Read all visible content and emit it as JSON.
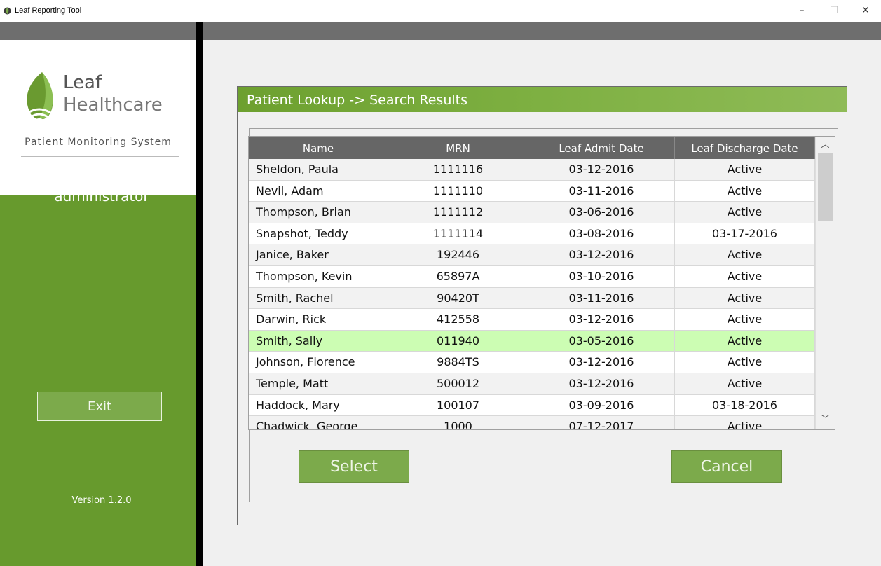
{
  "window": {
    "title": "Leaf Reporting Tool",
    "minimize": "–",
    "maximize": "☐",
    "close": "✕"
  },
  "sidebar": {
    "brand_line1": "Leaf",
    "brand_line2": "Healthcare",
    "tagline": "Patient Monitoring System",
    "username": "administrator",
    "exit_label": "Exit",
    "version": "Version 1.2.0"
  },
  "panel": {
    "title": "Patient Lookup -> Search Results",
    "select_label": "Select",
    "cancel_label": "Cancel"
  },
  "table": {
    "columns": [
      "Name",
      "MRN",
      "Leaf Admit Date",
      "Leaf Discharge Date"
    ],
    "rows": [
      {
        "name": "Sheldon, Paula",
        "mrn": "1111116",
        "admit": "03-12-2016",
        "discharge": "Active"
      },
      {
        "name": "Nevil, Adam",
        "mrn": "1111110",
        "admit": "03-11-2016",
        "discharge": "Active"
      },
      {
        "name": "Thompson, Brian",
        "mrn": "1111112",
        "admit": "03-06-2016",
        "discharge": "Active"
      },
      {
        "name": "Snapshot, Teddy",
        "mrn": "1111114",
        "admit": "03-08-2016",
        "discharge": "03-17-2016"
      },
      {
        "name": "Janice, Baker",
        "mrn": "192446",
        "admit": "03-12-2016",
        "discharge": "Active"
      },
      {
        "name": "Thompson, Kevin",
        "mrn": "65897A",
        "admit": "03-10-2016",
        "discharge": "Active"
      },
      {
        "name": "Smith, Rachel",
        "mrn": "90420T",
        "admit": "03-11-2016",
        "discharge": "Active"
      },
      {
        "name": "Darwin, Rick",
        "mrn": "412558",
        "admit": "03-12-2016",
        "discharge": "Active"
      },
      {
        "name": "Smith, Sally",
        "mrn": "011940",
        "admit": "03-05-2016",
        "discharge": "Active",
        "selected": true
      },
      {
        "name": "Johnson, Florence",
        "mrn": "9884TS",
        "admit": "03-12-2016",
        "discharge": "Active"
      },
      {
        "name": "Temple, Matt",
        "mrn": "500012",
        "admit": "03-12-2016",
        "discharge": "Active"
      },
      {
        "name": "Haddock, Mary",
        "mrn": "100107",
        "admit": "03-09-2016",
        "discharge": "03-18-2016"
      },
      {
        "name": "Chadwick, George",
        "mrn": "1000",
        "admit": "07-12-2017",
        "discharge": "Active"
      }
    ]
  },
  "colors": {
    "brand_green": "#679a2d",
    "button_green": "#7caa4b",
    "selected_row": "#ccfdb3"
  }
}
